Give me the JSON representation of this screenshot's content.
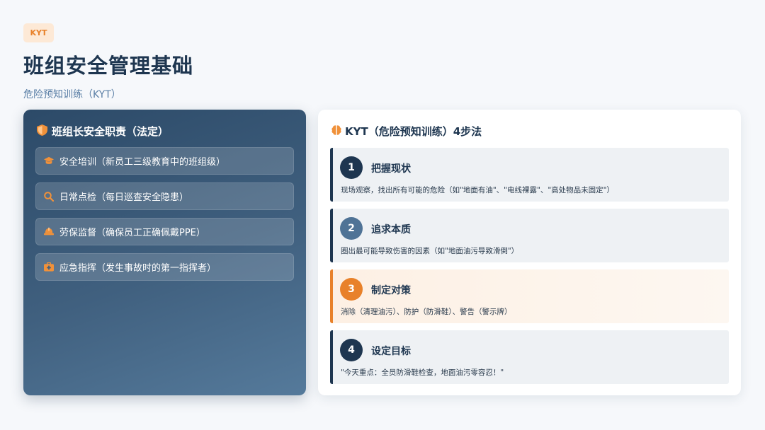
{
  "header": {
    "tag": "KYT",
    "title": "班组安全管理基础",
    "subtitle": "危险预知训练（KYT）"
  },
  "left": {
    "heading": "班组长安全职责（法定）",
    "heading_icon": "shield-icon",
    "items": [
      {
        "icon": "graduation-cap-icon",
        "label": "安全培训（新员工三级教育中的班组级）"
      },
      {
        "icon": "search-icon",
        "label": "日常点检（每日巡查安全隐患）"
      },
      {
        "icon": "hard-hat-icon",
        "label": "劳保监督（确保员工正确佩戴PPE）"
      },
      {
        "icon": "first-aid-icon",
        "label": "应急指挥（发生事故时的第一指挥者）"
      }
    ]
  },
  "right": {
    "heading": "KYT（危险预知训练）4步法",
    "heading_icon": "brain-icon",
    "steps": [
      {
        "num": "1",
        "title": "把握现状",
        "desc": "现场观察，找出所有可能的危险（如\"地面有油\"、\"电线裸露\"、\"高处物品未固定\"）"
      },
      {
        "num": "2",
        "title": "追求本质",
        "desc": "圈出最可能导致伤害的因素（如\"地面油污导致滑倒\"）"
      },
      {
        "num": "3",
        "title": "制定对策",
        "desc": "消除（清理油污）、防护（防滑鞋）、警告（警示牌）"
      },
      {
        "num": "4",
        "title": "设定目标",
        "desc": "\"今天重点：全员防滑鞋检查，地面油污零容忍！\""
      }
    ]
  },
  "colors": {
    "accent": "#e8812a",
    "navy": "#1e3650",
    "step2": "#4f7396"
  }
}
